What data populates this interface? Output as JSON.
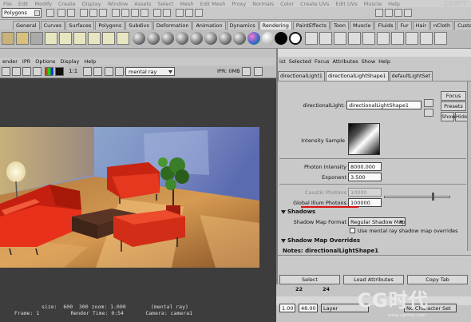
{
  "menu_bar": {
    "items": [
      "File",
      "Edit",
      "Modify",
      "Create",
      "Display",
      "Window",
      "Assets",
      "Select",
      "Mesh",
      "Edit Mesh",
      "Proxy",
      "Normals",
      "Color",
      "Create UVs",
      "Edit UVs",
      "Muscle",
      "Help"
    ]
  },
  "status_line": {
    "mode": "Polygons"
  },
  "shelf": {
    "tabs": [
      "General",
      "Curves",
      "Surfaces",
      "Polygons",
      "Subdivs",
      "Deformation",
      "Animation",
      "Dynamics",
      "Rendering",
      "PaintEffects",
      "Toon",
      "Muscle",
      "Fluids",
      "Fur",
      "Hair",
      "nCloth",
      "Custom"
    ],
    "active_tab": "Rendering"
  },
  "render_view": {
    "menu": [
      "ender",
      "IPR",
      "Options",
      "Display",
      "Help"
    ],
    "ratio_label": "1:1",
    "renderer": "mental ray",
    "ipr_status": "IPR: 0MB",
    "info_line1": "size:  600  300 zoom: 1.000        (mental ray)",
    "info_line2": "Frame: 1          Render Time: 0:54       Camera: camera1"
  },
  "attribute_editor": {
    "menu": [
      "ist",
      "Selected",
      "Focus",
      "Attributes",
      "Show",
      "Help"
    ],
    "tabs": [
      "directionalLight1",
      "directionalLightShape1",
      "defaultLightSet"
    ],
    "active_tab": "directionalLightShape1",
    "node_label": "directionalLight:",
    "node_value": "directionalLightShape1",
    "focus_button": "Focus",
    "presets_button": "Presets",
    "show_button": "Show",
    "hide_button": "Hide",
    "intensity_sample_label": "Intensity Sample",
    "photon_intensity_label": "Photon Intensity",
    "photon_intensity_value": "8000.000",
    "exponent_label": "Exponent",
    "exponent_value": "3.500",
    "caustic_photons_label": "Caustic Photons",
    "caustic_photons_value": "10000",
    "global_illum_photons_label": "Global Illum Photons",
    "global_illum_photons_value": "100000",
    "shadows_section": "Shadows",
    "shadow_map_format_label": "Shadow Map Format",
    "shadow_map_format_value": "Regular Shadow Map",
    "use_mr_shadow_map_label": "Use mental ray shadow map overrides",
    "shadow_map_overrides_section": "Shadow Map Overrides",
    "notes_label": "Notes:  directionalLightShape1",
    "select_button": "Select",
    "load_attributes_button": "Load Attributes",
    "copy_tab_button": "Copy Tab",
    "slider_fraction": 0.74
  },
  "timeline": {
    "ticks": [
      "22",
      "24"
    ],
    "start_field": "1.00",
    "end_field": "48.00",
    "layer_label": "Layer",
    "character_label": "No Character Set"
  },
  "watermark": {
    "text": "CG时代",
    "sub": "www.cgtime.com"
  },
  "colors": {
    "viewport_bg": "#3d3d3d",
    "highlight_red": "#d11111",
    "ui_gray": "#c8c8c8"
  }
}
